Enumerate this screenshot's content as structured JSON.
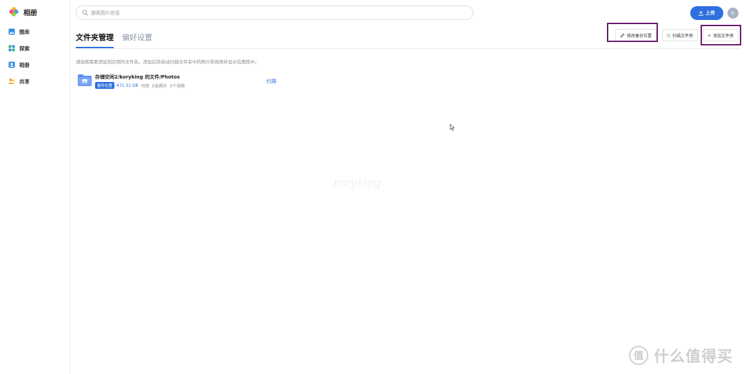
{
  "app": {
    "title": "相册"
  },
  "sidebar": {
    "items": [
      {
        "label": "图库",
        "icon": "gallery-icon"
      },
      {
        "label": "探索",
        "icon": "explore-icon"
      },
      {
        "label": "相册",
        "icon": "album-icon"
      },
      {
        "label": "共享",
        "icon": "share-icon"
      }
    ]
  },
  "search": {
    "placeholder": "搜索图片信息",
    "value": ""
  },
  "header": {
    "upload_label": "上传",
    "avatar_initial": "k"
  },
  "tabs": [
    {
      "label": "文件夹管理",
      "active": true
    },
    {
      "label": "偏好设置",
      "active": false
    }
  ],
  "toolbar": {
    "edit_backup_label": "修改备份位置",
    "scan_folder_label": "扫描文件夹",
    "add_folder_label": "添加文件夹"
  },
  "description": "请选择需要添加到应用的文件夹。添加后将自动扫描文件夹中的照片和视频并显示在图库中。",
  "folders": [
    {
      "path": "存储空间2/koryking 的文件/Photos",
      "badge": "备份位置",
      "size": "471.31 GB",
      "status": "可用",
      "photos": "0张照片",
      "videos": "0个视频",
      "action": "扫描"
    }
  ],
  "watermarks": {
    "center": "koryking",
    "corner_logo": "值",
    "corner_text": "什么值得买"
  },
  "colors": {
    "accent": "#2f6fe0",
    "highlight_box": "#6a1b6e"
  }
}
